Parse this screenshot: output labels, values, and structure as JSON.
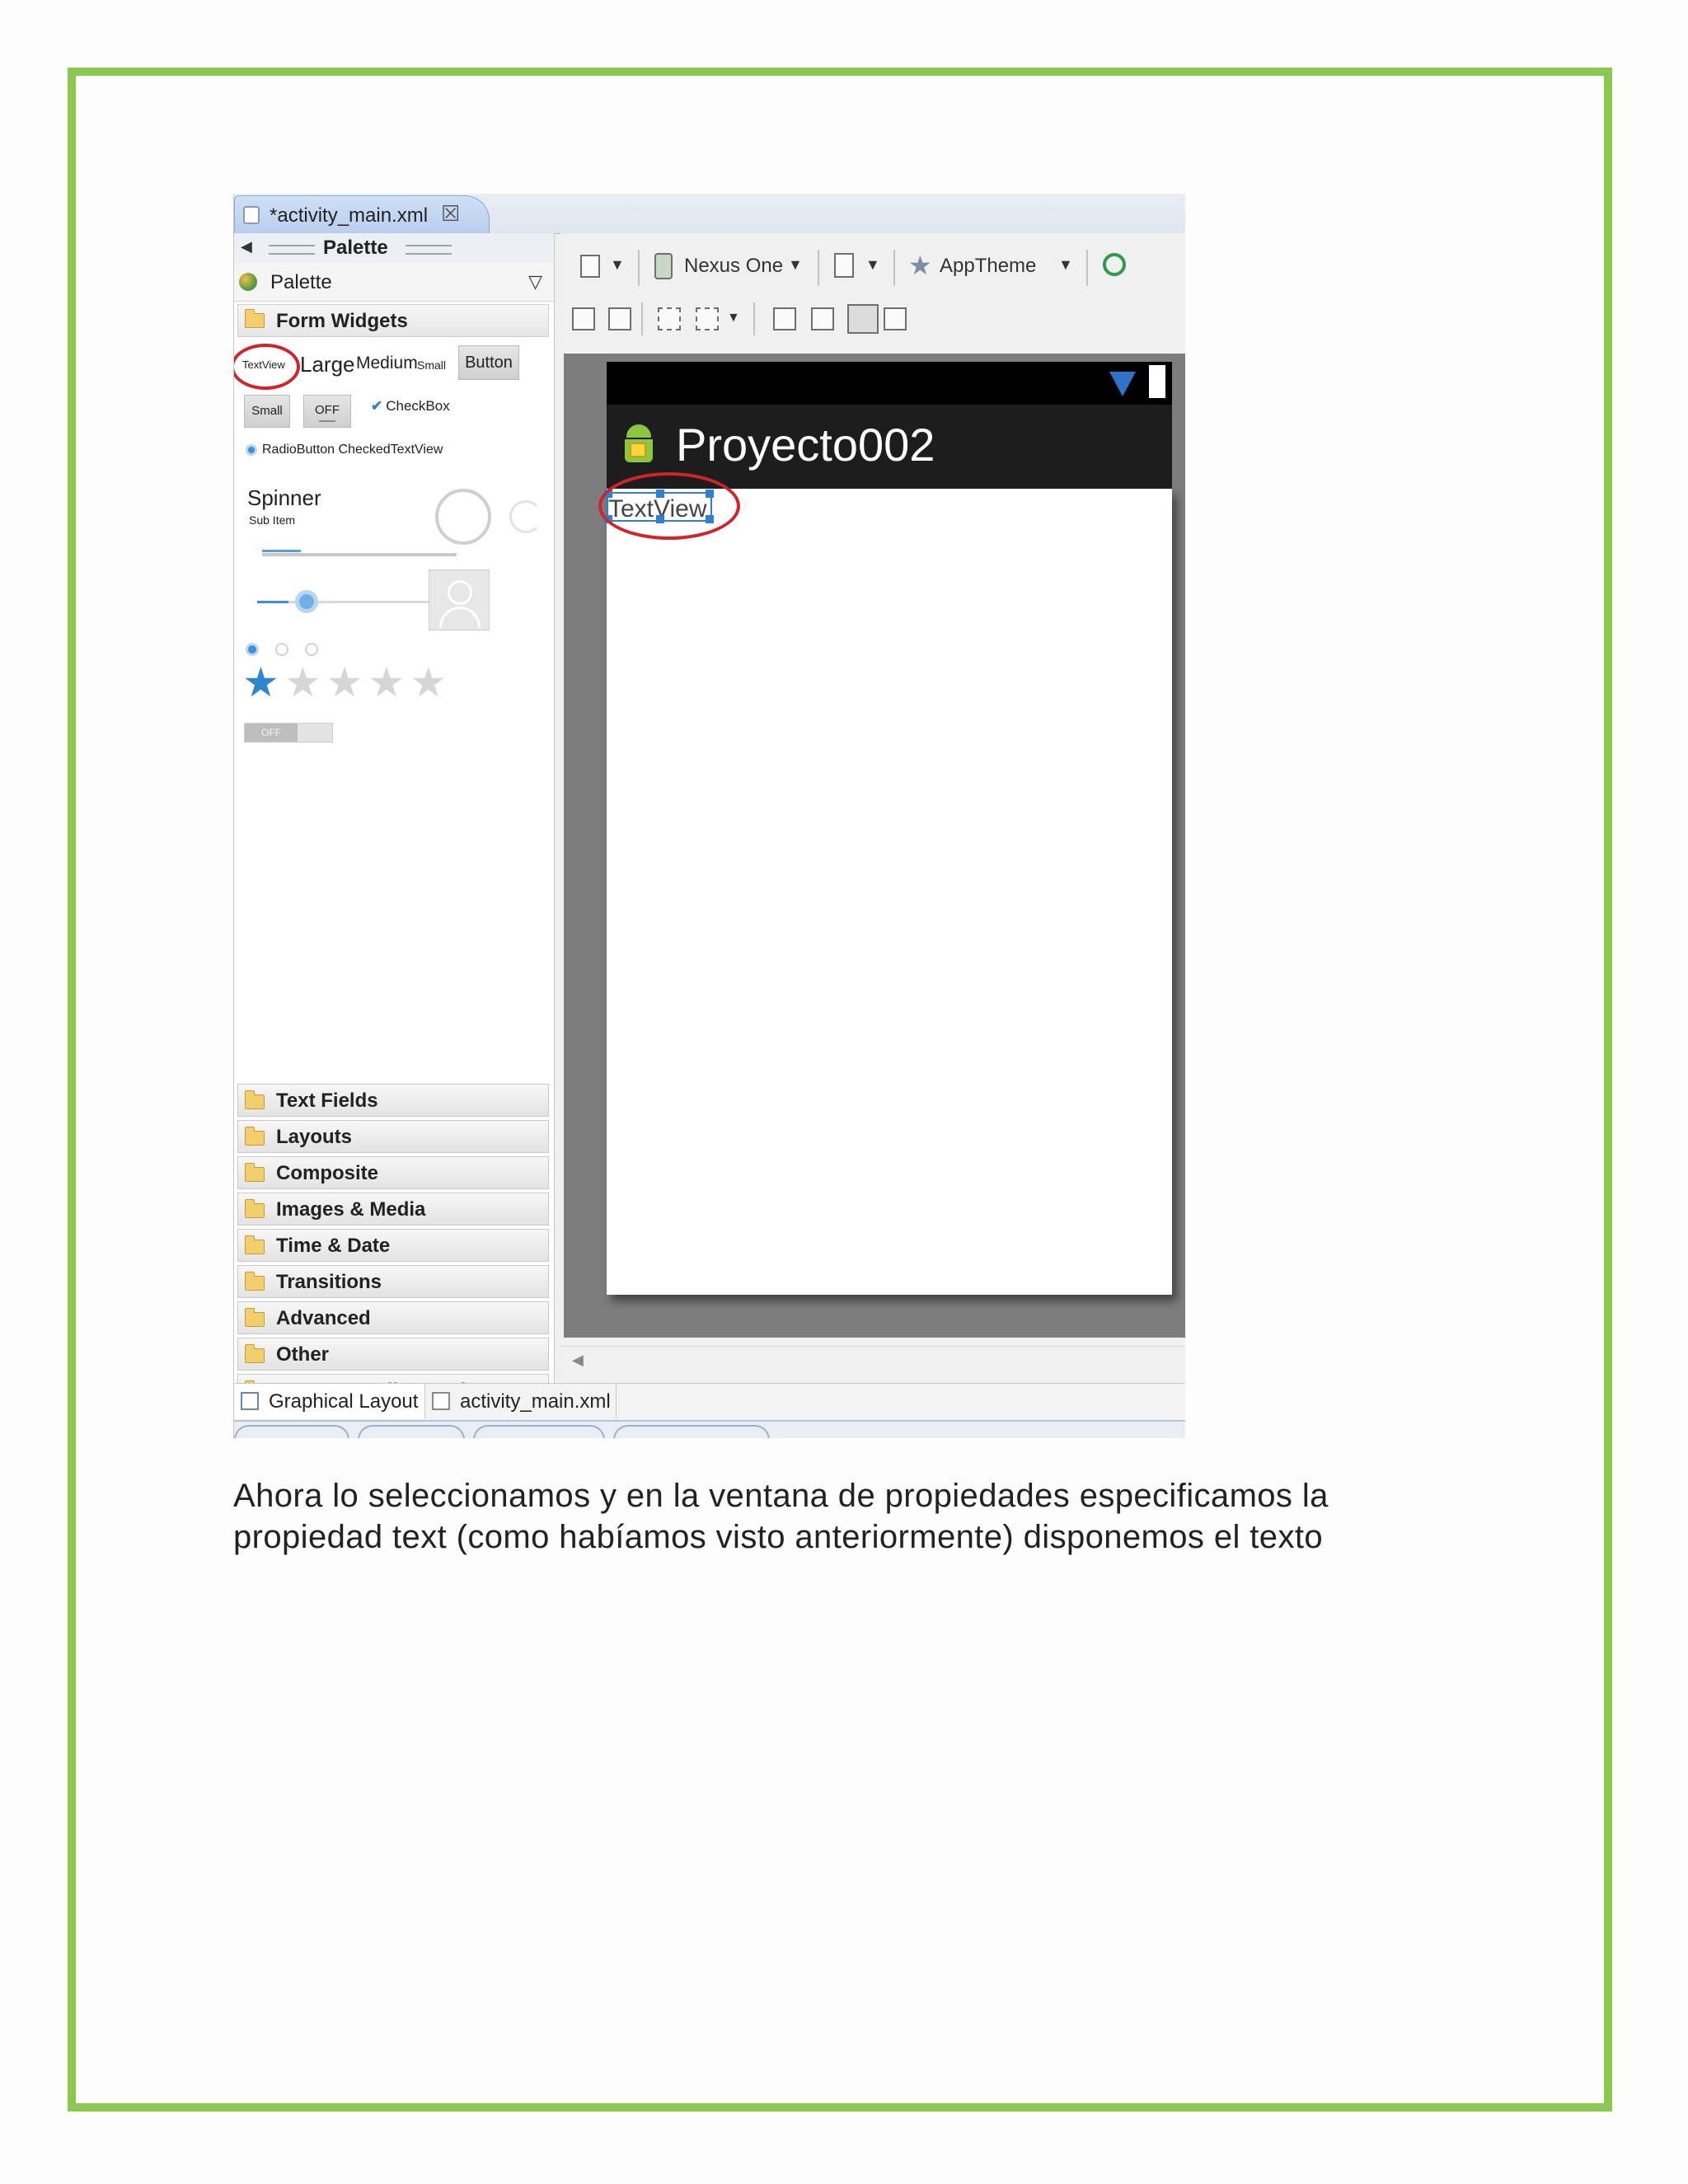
{
  "colors": {
    "border_green": "#8cc751",
    "highlight_red": "#d0242b",
    "selection_blue": "#2f7fd2",
    "action_bar": "#1d1d1d"
  },
  "editor_tab": {
    "title": "*activity_main.xml",
    "close": "☒",
    "icon": "layout-file-icon"
  },
  "palette": {
    "header_label": "Palette",
    "bar_label": "Palette",
    "open_category": "Form Widgets",
    "widgets": {
      "textview": "TextView",
      "large": "Large",
      "medium": "Medium",
      "small_text": "Small",
      "button": "Button",
      "small_button": "Small",
      "toggle": "OFF",
      "checkbox": "CheckBox",
      "radiobutton": "RadioButton",
      "checked_textview": "CheckedTextView",
      "spinner": "Spinner",
      "sub_item": "Sub Item",
      "switch": "OFF"
    },
    "progress_fraction": 0.2,
    "seek_fraction": 0.18,
    "rating": {
      "value": 1,
      "max": 5
    },
    "categories": [
      "Text Fields",
      "Layouts",
      "Composite",
      "Images & Media",
      "Time & Date",
      "Transitions",
      "Advanced",
      "Other",
      "Custom & Library Views"
    ]
  },
  "toolbar": {
    "device": "Nexus One",
    "theme": "AppTheme"
  },
  "phone": {
    "app_title": "Proyecto002",
    "textview_text": "TextView"
  },
  "bottom_tabs": [
    "Graphical Layout",
    "activity_main.xml"
  ],
  "caption": {
    "line1": "Ahora lo seleccionamos  y en la ventana de propiedades especificamos la",
    "line2": "propiedad text (como habíamos visto anteriormente) disponemos el texto"
  }
}
